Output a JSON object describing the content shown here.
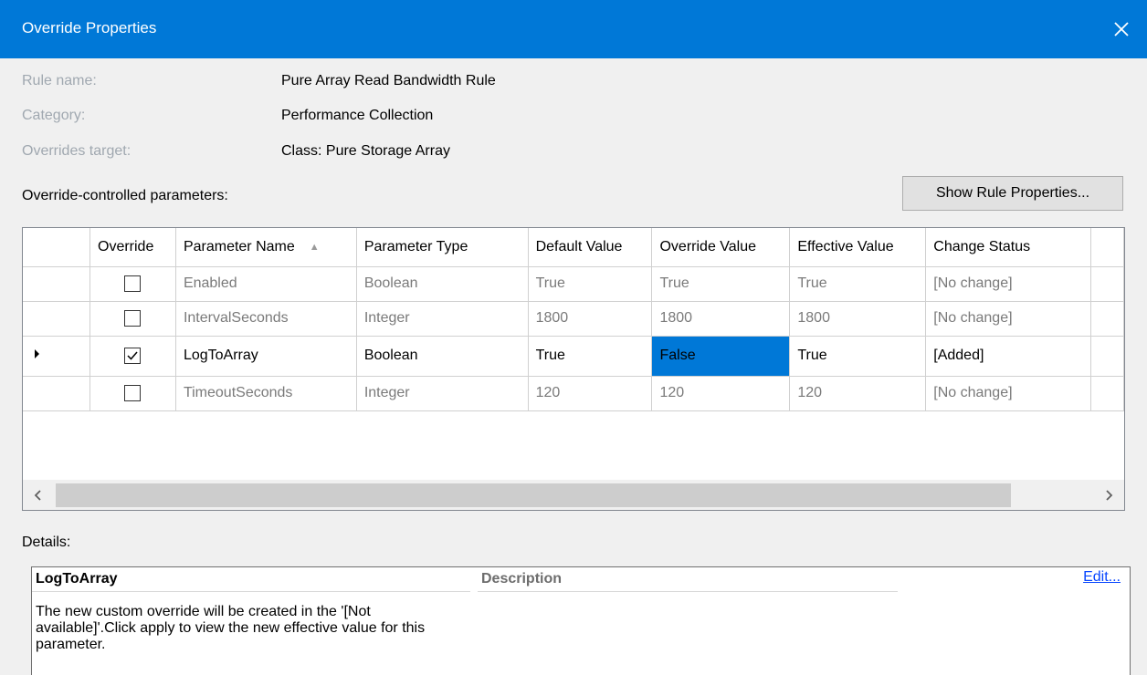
{
  "window": {
    "title": "Override Properties",
    "close_icon": "close-icon"
  },
  "properties": {
    "rule_name_label": "Rule name:",
    "rule_name_value": "Pure Array Read Bandwidth Rule",
    "category_label": "Category:",
    "category_value": "Performance Collection",
    "target_label": "Overrides target:",
    "target_value": "Class: Pure Storage Array"
  },
  "parameters_label": "Override-controlled parameters:",
  "show_rule_properties_button": "Show Rule Properties...",
  "grid": {
    "columns": [
      "Override",
      "Parameter Name",
      "Parameter Type",
      "Default Value",
      "Override Value",
      "Effective Value",
      "Change Status"
    ],
    "sort_icon": "sort-ascending-icon",
    "rows": [
      {
        "override": false,
        "name": "Enabled",
        "type": "Boolean",
        "default": "True",
        "override_value": "True",
        "effective": "True",
        "status": "[No change]"
      },
      {
        "override": false,
        "name": "IntervalSeconds",
        "type": "Integer",
        "default": "1800",
        "override_value": "1800",
        "effective": "1800",
        "status": "[No change]"
      },
      {
        "override": true,
        "name": "LogToArray",
        "type": "Boolean",
        "default": "True",
        "override_value": "False",
        "effective": "True",
        "status": "[Added]"
      },
      {
        "override": false,
        "name": "TimeoutSeconds",
        "type": "Integer",
        "default": "120",
        "override_value": "120",
        "effective": "120",
        "status": "[No change]"
      }
    ],
    "current_row_icon": "current-row-triangle-icon"
  },
  "details": {
    "label": "Details:",
    "parameter_name": "LogToArray",
    "description_header": "Description",
    "edit_link": "Edit...",
    "body": "The new custom override will be created in the '[Not available]'.Click apply to view  the new effective value for this parameter."
  },
  "colors": {
    "titlebar": "#0078d7",
    "selection": "#0078d7",
    "link": "#0645ff"
  }
}
